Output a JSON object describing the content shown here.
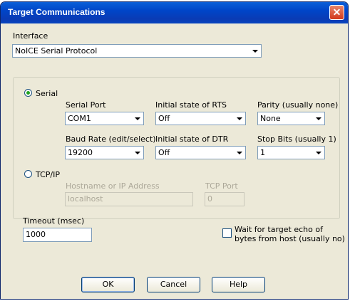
{
  "window": {
    "title": "Target Communications",
    "close": "✕"
  },
  "interface": {
    "label": "Interface",
    "value": "NoICE Serial Protocol"
  },
  "serial": {
    "radio_label": "Serial",
    "port": {
      "label": "Serial Port",
      "value": "COM1"
    },
    "rts": {
      "label": "Initial state of RTS",
      "value": "Off"
    },
    "parity": {
      "label": "Parity (usually none)",
      "value": "None"
    },
    "baud": {
      "label": "Baud Rate (edit/select)",
      "value": "19200"
    },
    "dtr": {
      "label": "Initial state of DTR",
      "value": "Off"
    },
    "stopbits": {
      "label": "Stop Bits (usually 1)",
      "value": "1"
    }
  },
  "tcpip": {
    "radio_label": "TCP/IP",
    "host": {
      "label": "Hostname or IP Address",
      "value": "localhost"
    },
    "port": {
      "label": "TCP Port",
      "value": "0"
    }
  },
  "timeout": {
    "label": "Timeout (msec)",
    "value": "1000"
  },
  "echo": {
    "line1": "Wait for target echo of",
    "line2": "bytes from host (usually no)"
  },
  "buttons": {
    "ok": "OK",
    "cancel": "Cancel",
    "help": "Help"
  }
}
